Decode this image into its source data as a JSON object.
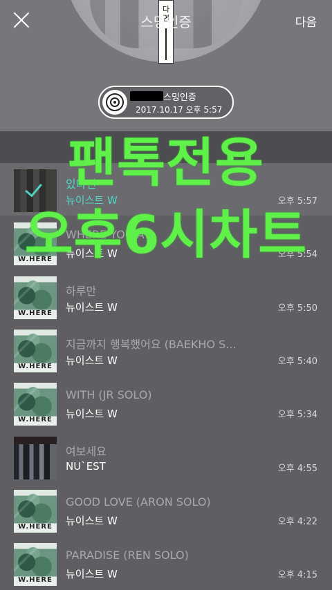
{
  "header": {
    "title": "스밍인증",
    "next_label": "다음",
    "spine_text": "다\n면"
  },
  "badge": {
    "label": "스밍인증",
    "datetime": "2017.10.17 오후 5:57"
  },
  "list_hint": "",
  "songs": [
    {
      "title": "있다면",
      "artist": "뉴이스트 W",
      "time": "오후 5:57",
      "art": "group",
      "selected": true
    },
    {
      "title": "WHERE YOU AT",
      "artist": "뉴이스트 W",
      "time": "오후 5:54",
      "art": "where"
    },
    {
      "title": "하루만",
      "artist": "뉴이스트 W",
      "time": "오후 5:50",
      "art": "where"
    },
    {
      "title": "지금까지 행복했어요 (BAEKHO S...",
      "artist": "뉴이스트 W",
      "time": "오후 5:40",
      "art": "where"
    },
    {
      "title": "WITH (JR SOLO)",
      "artist": "뉴이스트 W",
      "time": "오후 5:34",
      "art": "where"
    },
    {
      "title": "여보세요",
      "artist": "NU`EST",
      "time": "오후 4:55",
      "art": "dark"
    },
    {
      "title": "GOOD LOVE (ARON SOLO)",
      "artist": "뉴이스트 W",
      "time": "오후 4:22",
      "art": "where"
    },
    {
      "title": "PARADISE (REN SOLO)",
      "artist": "뉴이스트 W",
      "time": "오후 4:15",
      "art": "where"
    }
  ],
  "art_text": "W.HERE",
  "overlay": {
    "line1": "팬톡전용",
    "line2": "오후6시차트"
  },
  "colors": {
    "accent": "#4fd8c6",
    "overlay_green": "#5ff04a"
  }
}
